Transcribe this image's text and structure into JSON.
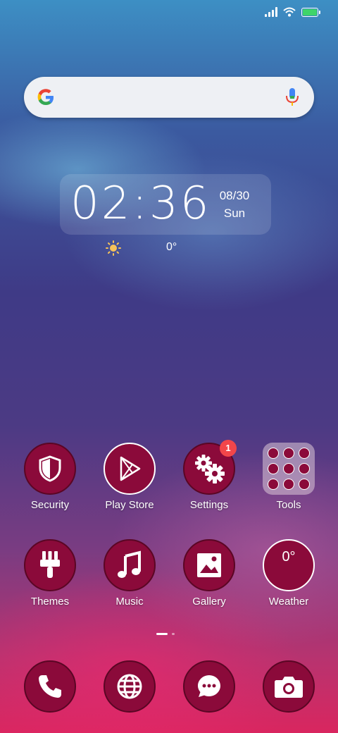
{
  "search": {},
  "clock": {
    "time": "02:36",
    "date": "08/30",
    "day": "Sun",
    "temperature": "0°"
  },
  "apps_row1": [
    {
      "label": "Security",
      "icon": "shield-icon"
    },
    {
      "label": "Play Store",
      "icon": "play-store-icon"
    },
    {
      "label": "Settings",
      "icon": "gears-icon",
      "badge": "1"
    },
    {
      "label": "Tools",
      "icon": "folder-icon"
    }
  ],
  "apps_row2": [
    {
      "label": "Themes",
      "icon": "brush-icon"
    },
    {
      "label": "Music",
      "icon": "music-note-icon"
    },
    {
      "label": "Gallery",
      "icon": "image-icon"
    },
    {
      "label": "Weather",
      "icon": "weather-icon",
      "value": "0°"
    }
  ],
  "dock": [
    {
      "icon": "phone-icon"
    },
    {
      "icon": "globe-icon"
    },
    {
      "icon": "message-icon"
    },
    {
      "icon": "camera-icon"
    }
  ],
  "page_indicator": {
    "pages": 2,
    "current": 1
  },
  "colors": {
    "icon_bg": "#8b0a3a",
    "badge": "#f2464a",
    "battery": "#3fd46a"
  }
}
